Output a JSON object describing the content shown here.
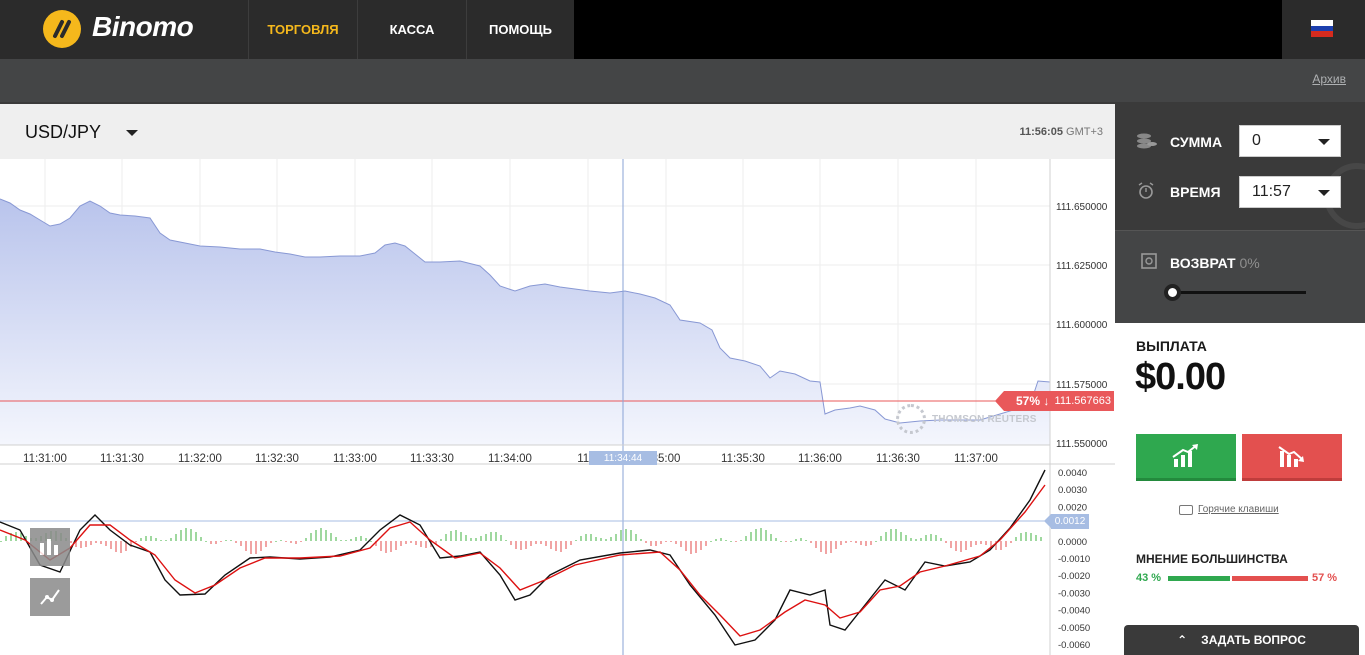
{
  "brand": {
    "name": "Binomo",
    "logo_color": "#f5b81c"
  },
  "nav": [
    {
      "label": "ТОРГОВЛЯ",
      "active": true
    },
    {
      "label": "КАССА",
      "active": false
    },
    {
      "label": "ПОМОЩЬ",
      "active": false
    }
  ],
  "flag": {
    "colors": [
      "#ffffff",
      "#1c3fae",
      "#d52b1e"
    ]
  },
  "subbar": {
    "archive_link": "Архив"
  },
  "chart_header": {
    "asset": "USD/JPY",
    "time": "11:56:05",
    "tz": "GMT+3"
  },
  "price_axis": [
    "111.650000",
    "111.625000",
    "111.600000",
    "111.575000",
    "111.550000"
  ],
  "time_axis": [
    "11:31:00",
    "11:31:30",
    "11:32:00",
    "11:32:30",
    "11:33:00",
    "11:33:30",
    "11:34:00",
    "11:3",
    "35:00",
    "11:35:30",
    "11:36:00",
    "11:36:30",
    "11:37:00"
  ],
  "crosshair_time": "11:34:44",
  "price_tag": {
    "percent": "57% ↓",
    "value": "111.567663"
  },
  "watermark": "THOMSON REUTERS",
  "macd_axis": [
    "0.0040",
    "0.0030",
    "0.0020",
    "0.0010",
    "0.0000",
    "-0.0010",
    "-0.0020",
    "-0.0030",
    "-0.0040",
    "-0.0050",
    "-0.0060"
  ],
  "macd_value": "0.0012",
  "panel": {
    "amount_label": "СУММА",
    "amount_value": "0",
    "time_label": "ВРЕМЯ",
    "time_value": "11:57",
    "return_label": "ВОЗВРАТ",
    "return_value": "0%",
    "payout_label": "ВЫПЛАТА",
    "payout_value": "$0.00",
    "hotkeys": "Горячие клавиши",
    "majority_label": "МНЕНИЕ БОЛЬШИНСТВА",
    "majority_up": "43 %",
    "majority_down": "57 %",
    "ask_button": "ЗАДАТЬ ВОПРОС"
  },
  "colors": {
    "up": "#2fa84f",
    "down": "#e3504f",
    "accent": "#f5b81c"
  }
}
